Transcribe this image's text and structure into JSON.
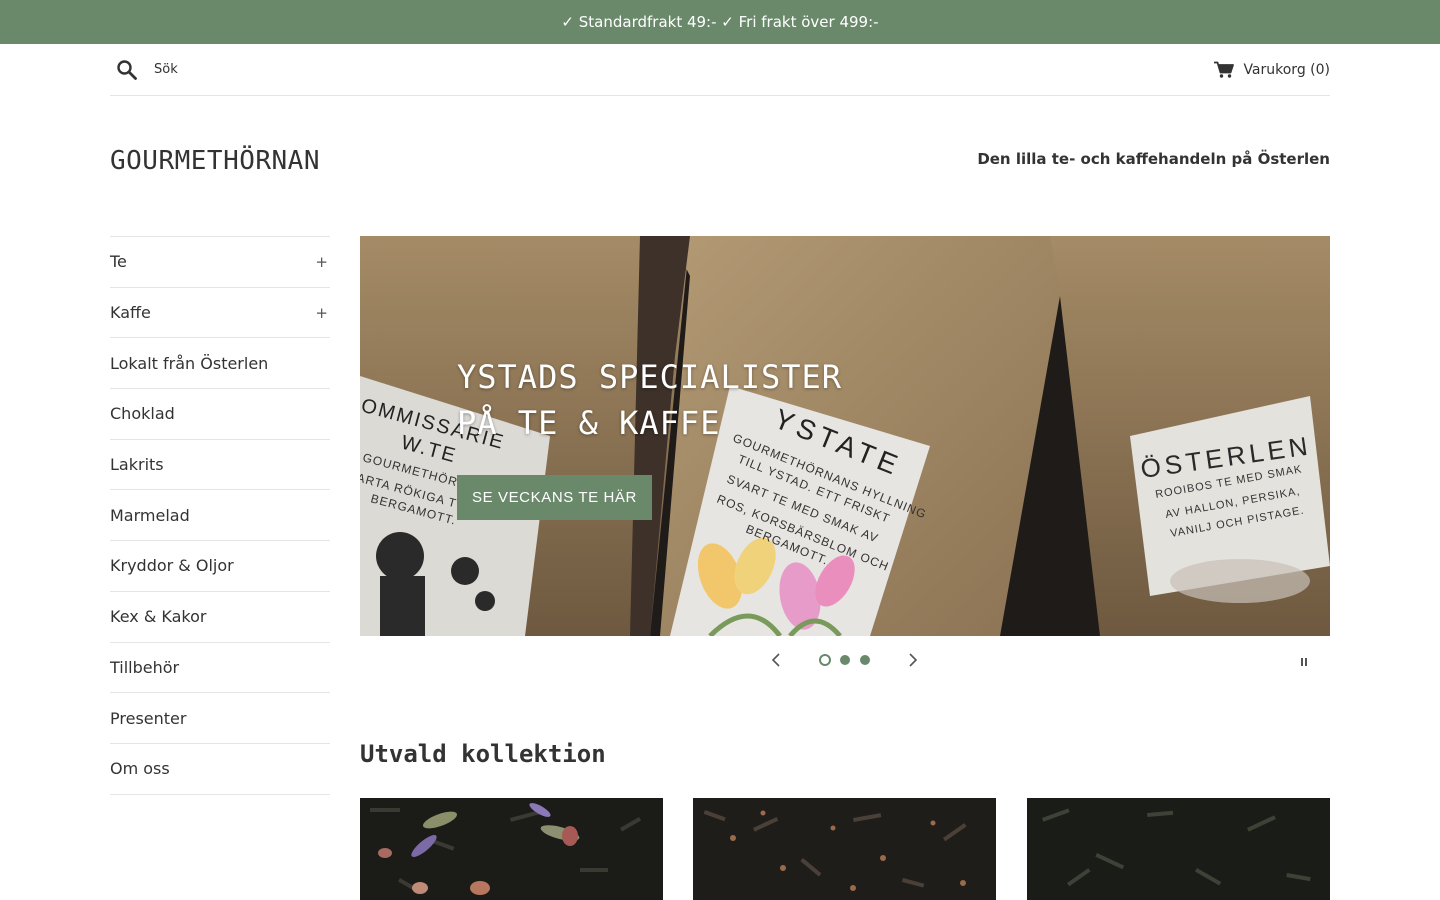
{
  "announcement": "✓ Standardfrakt 49:- ✓ Fri frakt över 499:-",
  "search": {
    "placeholder": "Sök"
  },
  "cart": {
    "label": "Varukorg (0)"
  },
  "brand": {
    "logo": "GOURMETHÖRNAN",
    "tagline": "Den lilla te- och kaffehandeln på Österlen"
  },
  "nav": {
    "items": [
      {
        "label": "Te",
        "expandable": "+"
      },
      {
        "label": "Kaffe",
        "expandable": "+"
      },
      {
        "label": "Lokalt från Österlen"
      },
      {
        "label": "Choklad"
      },
      {
        "label": "Lakrits"
      },
      {
        "label": "Marmelad"
      },
      {
        "label": "Kryddor & Oljor"
      },
      {
        "label": "Kex & Kakor"
      },
      {
        "label": "Tillbehör"
      },
      {
        "label": "Presenter"
      },
      {
        "label": "Om oss"
      }
    ]
  },
  "hero": {
    "headline_line1": "YSTADS SPECIALISTER",
    "headline_line2": "PÅ TE & KAFFE",
    "cta": "SE VECKANS TE HÄR",
    "slide_count": 3,
    "active_slide": 1,
    "bags": {
      "left_title_1": "OMMISSARIE",
      "left_title_2": "W.TE",
      "left_desc_1": "GOURMETHÖRN",
      "left_desc_2": "ARTA RÖKIGA T",
      "left_desc_3": "BERGAMOTT.",
      "mid_title": "YSTATE",
      "mid_desc_1": "GOURMETHÖRNANS HYLLNING",
      "mid_desc_2": "TILL YSTAD. ETT FRISKT",
      "mid_desc_3": "SVART TE MED SMAK AV",
      "mid_desc_4": "ROS, KORSBÄRSBLOM OCH",
      "mid_desc_5": "BERGAMOTT.",
      "right_title": "ÖSTERLEN",
      "right_desc_1": "ROOIBOS TE MED SMAK",
      "right_desc_2": "AV HALLON, PERSIKA,",
      "right_desc_3": "VANILJ OCH PISTAGE."
    }
  },
  "featured": {
    "title": "Utvald kollektion"
  },
  "colors": {
    "accent": "#69896a",
    "text": "#333333",
    "border": "#e5e5e5"
  },
  "icons": {
    "search": "search-icon",
    "cart": "cart-icon",
    "prev": "chevron-left-icon",
    "next": "chevron-right-icon",
    "pause": "pause-icon"
  }
}
